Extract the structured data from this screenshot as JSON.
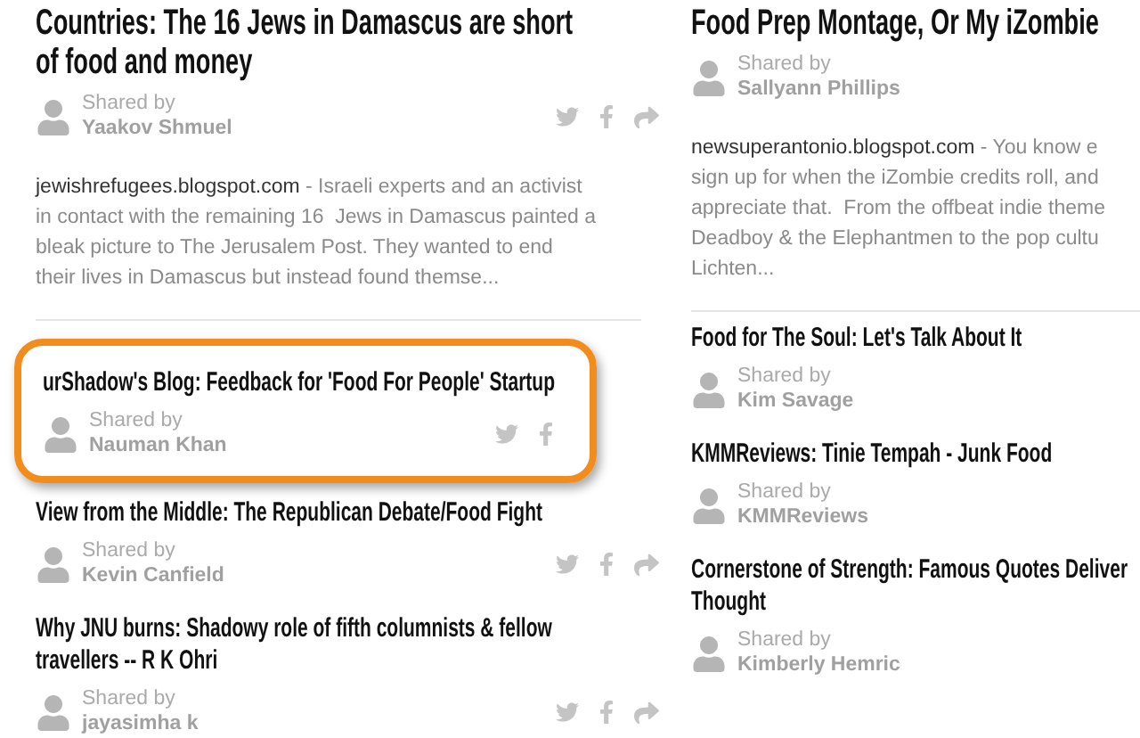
{
  "columns": [
    {
      "posts": [
        {
          "title": [
            "Countries: The 16 Jews in Damascus are short",
            "of food and money"
          ],
          "kind": "featured",
          "shared_by": "Shared by",
          "sharer": "Yaakov Shmuel",
          "highlighted": false,
          "excerpt": {
            "source": "jewishrefugees.blogspot.com",
            "lines": [
              " - Israeli experts and an activist",
              "in contact with the remaining 16  Jews in Damascus painted a",
              "bleak picture to The Jerusalem Post. They wanted to end",
              "their lives in Damascus but instead found themse..."
            ]
          }
        },
        {
          "title": [
            "urShadow's Blog: Feedback for 'Food For People' Startup"
          ],
          "kind": "compact",
          "shared_by": "Shared by",
          "sharer": "Nauman Khan",
          "highlighted": true
        },
        {
          "title": [
            "View from the Middle: The Republican Debate/Food Fight"
          ],
          "kind": "compact",
          "shared_by": "Shared by",
          "sharer": "Kevin Canfield",
          "highlighted": false
        },
        {
          "title": [
            "Why JNU burns: Shadowy role of fifth columnists & fellow",
            "travellers -- R K Ohri"
          ],
          "kind": "compact",
          "shared_by": "Shared by",
          "sharer": "jayasimha k",
          "highlighted": false
        }
      ]
    },
    {
      "posts": [
        {
          "title": [
            "Food Prep Montage, Or My iZombie"
          ],
          "kind": "featured",
          "shared_by": "Shared by",
          "sharer": "Sallyann Phillips",
          "highlighted": false,
          "excerpt": {
            "source": "newsuperantonio.blogspot.com",
            "lines": [
              " - You know e",
              "sign up for when the iZombie credits roll, and",
              "appreciate that.  From the offbeat indie theme",
              "Deadboy & the Elephantmen to the pop cultu",
              "Lichten..."
            ]
          }
        },
        {
          "title": [
            "Food for The Soul: Let's Talk About It"
          ],
          "kind": "compact",
          "shared_by": "Shared by",
          "sharer": "Kim Savage",
          "highlighted": false
        },
        {
          "title": [
            "KMMReviews: Tinie Tempah - Junk Food"
          ],
          "kind": "compact",
          "shared_by": "Shared by",
          "sharer": "KMMReviews",
          "highlighted": false
        },
        {
          "title": [
            "Cornerstone of Strength: Famous Quotes Deliver",
            "Thought"
          ],
          "kind": "compact",
          "shared_by": "Shared by",
          "sharer": "Kimberly Hemric",
          "highlighted": false
        }
      ]
    }
  ]
}
